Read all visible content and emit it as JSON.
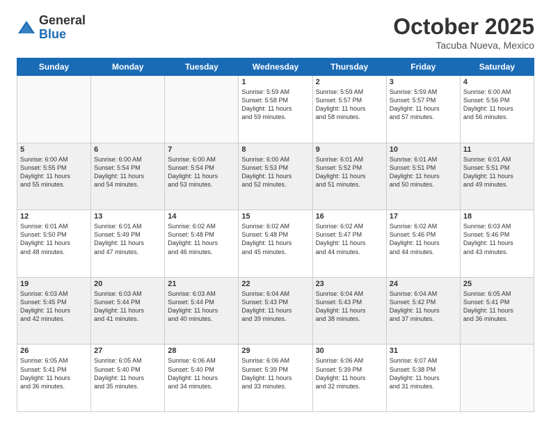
{
  "logo": {
    "general": "General",
    "blue": "Blue"
  },
  "header": {
    "month": "October 2025",
    "location": "Tacuba Nueva, Mexico"
  },
  "weekdays": [
    "Sunday",
    "Monday",
    "Tuesday",
    "Wednesday",
    "Thursday",
    "Friday",
    "Saturday"
  ],
  "weeks": [
    [
      {
        "day": "",
        "info": ""
      },
      {
        "day": "",
        "info": ""
      },
      {
        "day": "",
        "info": ""
      },
      {
        "day": "1",
        "info": "Sunrise: 5:59 AM\nSunset: 5:58 PM\nDaylight: 11 hours\nand 59 minutes."
      },
      {
        "day": "2",
        "info": "Sunrise: 5:59 AM\nSunset: 5:57 PM\nDaylight: 11 hours\nand 58 minutes."
      },
      {
        "day": "3",
        "info": "Sunrise: 5:59 AM\nSunset: 5:57 PM\nDaylight: 11 hours\nand 57 minutes."
      },
      {
        "day": "4",
        "info": "Sunrise: 6:00 AM\nSunset: 5:56 PM\nDaylight: 11 hours\nand 56 minutes."
      }
    ],
    [
      {
        "day": "5",
        "info": "Sunrise: 6:00 AM\nSunset: 5:55 PM\nDaylight: 11 hours\nand 55 minutes."
      },
      {
        "day": "6",
        "info": "Sunrise: 6:00 AM\nSunset: 5:54 PM\nDaylight: 11 hours\nand 54 minutes."
      },
      {
        "day": "7",
        "info": "Sunrise: 6:00 AM\nSunset: 5:54 PM\nDaylight: 11 hours\nand 53 minutes."
      },
      {
        "day": "8",
        "info": "Sunrise: 6:00 AM\nSunset: 5:53 PM\nDaylight: 11 hours\nand 52 minutes."
      },
      {
        "day": "9",
        "info": "Sunrise: 6:01 AM\nSunset: 5:52 PM\nDaylight: 11 hours\nand 51 minutes."
      },
      {
        "day": "10",
        "info": "Sunrise: 6:01 AM\nSunset: 5:51 PM\nDaylight: 11 hours\nand 50 minutes."
      },
      {
        "day": "11",
        "info": "Sunrise: 6:01 AM\nSunset: 5:51 PM\nDaylight: 11 hours\nand 49 minutes."
      }
    ],
    [
      {
        "day": "12",
        "info": "Sunrise: 6:01 AM\nSunset: 5:50 PM\nDaylight: 11 hours\nand 48 minutes."
      },
      {
        "day": "13",
        "info": "Sunrise: 6:01 AM\nSunset: 5:49 PM\nDaylight: 11 hours\nand 47 minutes."
      },
      {
        "day": "14",
        "info": "Sunrise: 6:02 AM\nSunset: 5:48 PM\nDaylight: 11 hours\nand 46 minutes."
      },
      {
        "day": "15",
        "info": "Sunrise: 6:02 AM\nSunset: 5:48 PM\nDaylight: 11 hours\nand 45 minutes."
      },
      {
        "day": "16",
        "info": "Sunrise: 6:02 AM\nSunset: 5:47 PM\nDaylight: 11 hours\nand 44 minutes."
      },
      {
        "day": "17",
        "info": "Sunrise: 6:02 AM\nSunset: 5:46 PM\nDaylight: 11 hours\nand 44 minutes."
      },
      {
        "day": "18",
        "info": "Sunrise: 6:03 AM\nSunset: 5:46 PM\nDaylight: 11 hours\nand 43 minutes."
      }
    ],
    [
      {
        "day": "19",
        "info": "Sunrise: 6:03 AM\nSunset: 5:45 PM\nDaylight: 11 hours\nand 42 minutes."
      },
      {
        "day": "20",
        "info": "Sunrise: 6:03 AM\nSunset: 5:44 PM\nDaylight: 11 hours\nand 41 minutes."
      },
      {
        "day": "21",
        "info": "Sunrise: 6:03 AM\nSunset: 5:44 PM\nDaylight: 11 hours\nand 40 minutes."
      },
      {
        "day": "22",
        "info": "Sunrise: 6:04 AM\nSunset: 5:43 PM\nDaylight: 11 hours\nand 39 minutes."
      },
      {
        "day": "23",
        "info": "Sunrise: 6:04 AM\nSunset: 5:43 PM\nDaylight: 11 hours\nand 38 minutes."
      },
      {
        "day": "24",
        "info": "Sunrise: 6:04 AM\nSunset: 5:42 PM\nDaylight: 11 hours\nand 37 minutes."
      },
      {
        "day": "25",
        "info": "Sunrise: 6:05 AM\nSunset: 5:41 PM\nDaylight: 11 hours\nand 36 minutes."
      }
    ],
    [
      {
        "day": "26",
        "info": "Sunrise: 6:05 AM\nSunset: 5:41 PM\nDaylight: 11 hours\nand 36 minutes."
      },
      {
        "day": "27",
        "info": "Sunrise: 6:05 AM\nSunset: 5:40 PM\nDaylight: 11 hours\nand 35 minutes."
      },
      {
        "day": "28",
        "info": "Sunrise: 6:06 AM\nSunset: 5:40 PM\nDaylight: 11 hours\nand 34 minutes."
      },
      {
        "day": "29",
        "info": "Sunrise: 6:06 AM\nSunset: 5:39 PM\nDaylight: 11 hours\nand 33 minutes."
      },
      {
        "day": "30",
        "info": "Sunrise: 6:06 AM\nSunset: 5:39 PM\nDaylight: 11 hours\nand 32 minutes."
      },
      {
        "day": "31",
        "info": "Sunrise: 6:07 AM\nSunset: 5:38 PM\nDaylight: 11 hours\nand 31 minutes."
      },
      {
        "day": "",
        "info": ""
      }
    ]
  ]
}
